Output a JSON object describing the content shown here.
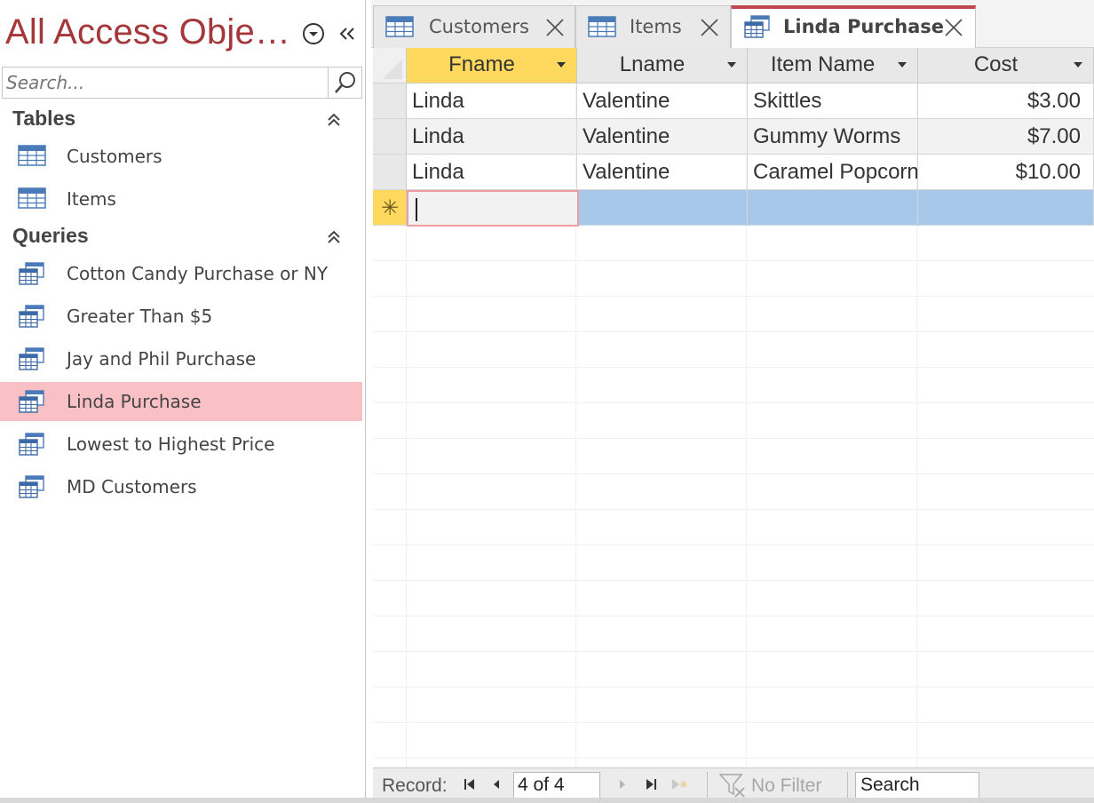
{
  "nav": {
    "title": "All Access Obje…",
    "search_placeholder": "Search...",
    "groups": [
      {
        "label": "Tables",
        "items": [
          {
            "label": "Customers",
            "icon": "table-icon"
          },
          {
            "label": "Items",
            "icon": "table-icon"
          }
        ]
      },
      {
        "label": "Queries",
        "items": [
          {
            "label": "Cotton Candy Purchase or NY",
            "icon": "query-icon"
          },
          {
            "label": "Greater Than $5",
            "icon": "query-icon"
          },
          {
            "label": "Jay and Phil Purchase",
            "icon": "query-icon"
          },
          {
            "label": "Linda Purchase",
            "icon": "query-icon",
            "selected": true
          },
          {
            "label": "Lowest to Highest Price",
            "icon": "query-icon"
          },
          {
            "label": "MD Customers",
            "icon": "query-icon"
          }
        ]
      }
    ]
  },
  "tabs": [
    {
      "label": "Customers",
      "icon": "table-icon"
    },
    {
      "label": "Items",
      "icon": "table-icon"
    },
    {
      "label": "Linda Purchase",
      "icon": "query-icon",
      "active": true
    }
  ],
  "grid": {
    "columns": [
      "Fname",
      "Lname",
      "Item Name",
      "Cost"
    ],
    "rows": [
      [
        "Linda",
        "Valentine",
        "Skittles",
        "$3.00"
      ],
      [
        "Linda",
        "Valentine",
        "Gummy Worms",
        "$7.00"
      ],
      [
        "Linda",
        "Valentine",
        "Caramel Popcorn",
        "$10.00"
      ]
    ],
    "new_row_marker": "✳"
  },
  "record_nav": {
    "label": "Record:",
    "position": "4 of 4",
    "filter_label": "No Filter",
    "search_value": "Search"
  },
  "colors": {
    "accent": "#a4373a",
    "selected_nav": "#f9c1c5",
    "header_selected": "#ffd95e",
    "new_row": "#a7c8e8"
  }
}
